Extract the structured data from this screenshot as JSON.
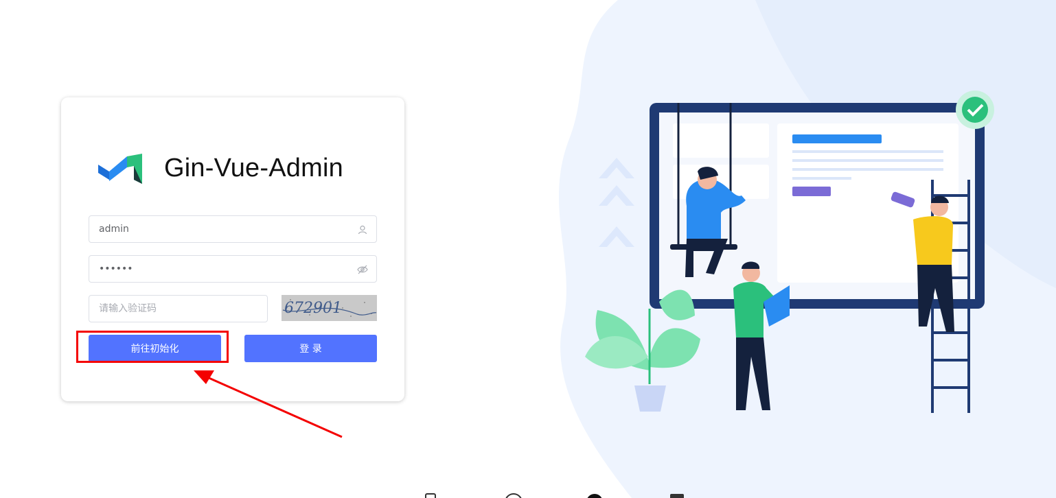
{
  "brand": {
    "name": "Gin-Vue-Admin"
  },
  "form": {
    "username": {
      "value": "admin",
      "icon": "user-icon"
    },
    "password": {
      "value": "••••••",
      "icon": "eye-hidden-icon"
    },
    "captcha": {
      "placeholder": "请输入验证码",
      "image_text": "672901"
    }
  },
  "buttons": {
    "init_label": "前往初始化",
    "login_label": "登 录"
  },
  "colors": {
    "primary": "#5273ff",
    "annotation": "#f40000",
    "illustration_blue": "#1f3a73",
    "leaf_green": "#7de2b0"
  }
}
